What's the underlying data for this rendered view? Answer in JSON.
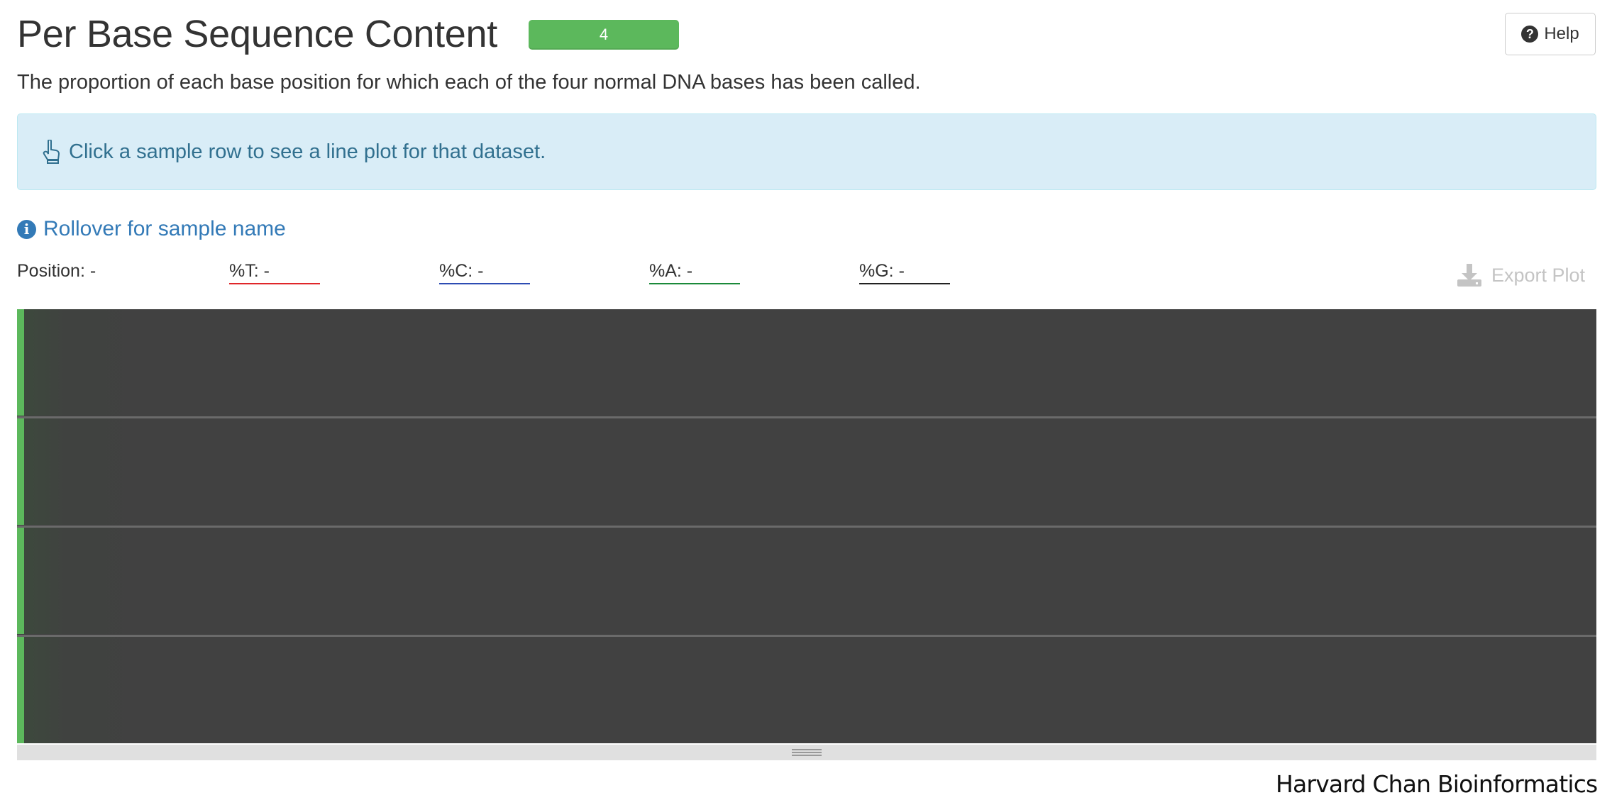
{
  "header": {
    "title": "Per Base Sequence Content",
    "status_count": "4",
    "help_label": "Help"
  },
  "description": "The proportion of each base position for which each of the four normal DNA bases has been called.",
  "info_box": {
    "text": "Click a sample row to see a line plot for that dataset."
  },
  "rollover": {
    "label": "Rollover for sample name"
  },
  "readouts": {
    "position": "Position: -",
    "t": "%T: -",
    "c": "%C: -",
    "a": "%A: -",
    "g": "%G: -"
  },
  "export_label": "Export Plot",
  "heatmap": {
    "row_count": 4,
    "status_color": "#5cb85c",
    "cell_color": "#414141"
  },
  "colors": {
    "t_underline": "#e0262a",
    "c_underline": "#2d4cb3",
    "a_underline": "#1b8a3a",
    "g_underline": "#222222",
    "status_pass": "#5cb85c",
    "link": "#337ab7",
    "info_text": "#31708f"
  },
  "credit": "Harvard Chan Bioinformatics Core"
}
